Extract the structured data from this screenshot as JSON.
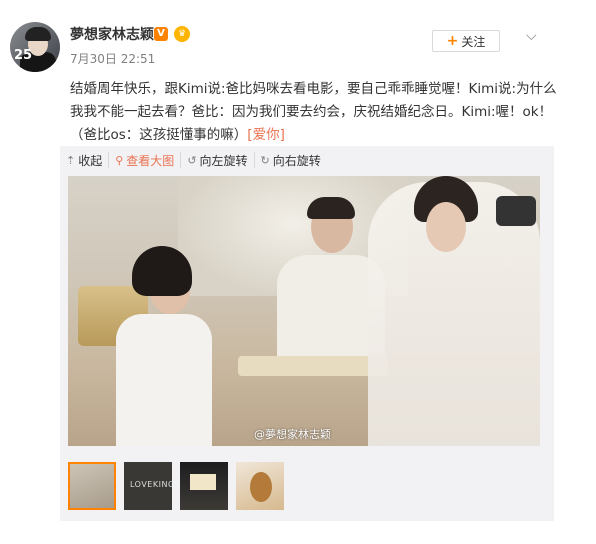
{
  "post": {
    "avatar_badge": "25",
    "username": "夢想家林志颖",
    "verified_badge": "V",
    "timestamp": "7月30日 22:51",
    "follow_label": "关注",
    "text_line1": "结婚周年快乐，跟Kimi说:爸比妈咪去看电影，要自己乖乖睡觉喔！Kimi说:为什么",
    "text_line2": "我我不能一起去看？爸比：因为我们要去约会，庆祝结婚纪念日。Kimi:喔！ok！",
    "text_line3_a": "（爸比os：这孩挺懂事的嘛）",
    "text_line3_b": "[爱你]"
  },
  "toolbar": {
    "collect_label": "收起",
    "zoom_label": "查看大图",
    "rotate_left_label": "向左旋转",
    "rotate_right_label": "向右旋转"
  },
  "photo": {
    "watermark": "@夢想家林志颖"
  },
  "thumbnails": {
    "t2_text": "LOVEKING"
  },
  "colors": {
    "accent": "#ff8200",
    "link": "#eb7350",
    "panel": "#f2f2f5"
  }
}
